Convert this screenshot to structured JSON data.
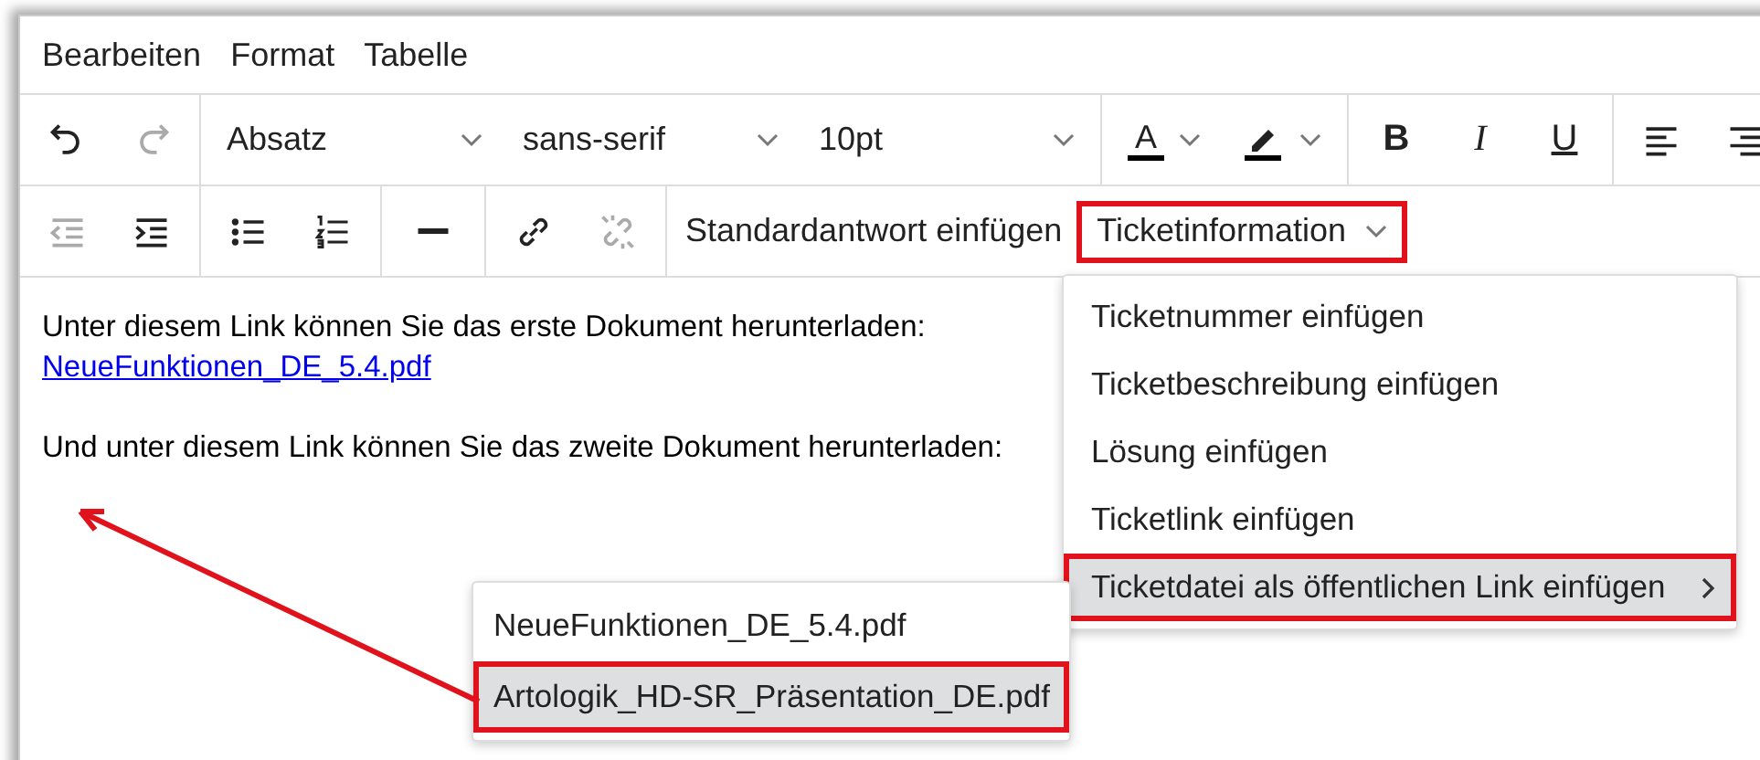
{
  "menubar": [
    {
      "label": "Bearbeiten"
    },
    {
      "label": "Format"
    },
    {
      "label": "Tabelle"
    }
  ],
  "toolbar_row_1": {
    "history": [
      {
        "kind": "undo",
        "disabled": false
      },
      {
        "kind": "redo",
        "disabled": true
      }
    ],
    "selects": [
      {
        "value": "Absatz"
      },
      {
        "value": "sans-serif"
      },
      {
        "value": "10pt"
      }
    ],
    "colors": [
      {
        "kind": "text-color",
        "glyph": "A"
      },
      {
        "kind": "highlight"
      }
    ],
    "formats": [
      {
        "kind": "bold",
        "glyph": "B"
      },
      {
        "kind": "italic",
        "glyph": "I"
      },
      {
        "kind": "underline",
        "glyph": "U"
      }
    ],
    "align": [
      {
        "kind": "left"
      },
      {
        "kind": "right"
      }
    ]
  },
  "toolbar_row_2": {
    "indent": [
      {
        "kind": "outdent",
        "disabled": true
      },
      {
        "kind": "indent",
        "disabled": false
      }
    ],
    "lists": [
      {
        "kind": "bullet"
      },
      {
        "kind": "numbered"
      }
    ],
    "rule": [
      {
        "kind": "hr"
      }
    ],
    "links": [
      {
        "kind": "link",
        "disabled": false
      },
      {
        "kind": "unlink",
        "disabled": true
      }
    ],
    "standard_reply": {
      "label": "Standardantwort einfügen"
    },
    "ticket_info": {
      "label": "Ticketinformation",
      "callout": true
    }
  },
  "content": {
    "paragraphs": [
      {
        "lines": [
          {
            "kind": "text",
            "text": "Unter diesem Link können Sie das erste Dokument herunterladen:"
          },
          {
            "kind": "link",
            "text": "NeueFunktionen_DE_5.4.pdf"
          }
        ]
      },
      {
        "lines": [
          {
            "kind": "text",
            "text": "Und unter diesem Link können Sie das zweite Dokument herunterladen:"
          }
        ]
      }
    ]
  },
  "ticket_menu": {
    "items": [
      {
        "label": "Ticketnummer einfügen",
        "selected": false,
        "callout": false,
        "submenu": false
      },
      {
        "label": "Ticketbeschreibung einfügen",
        "selected": false,
        "callout": false,
        "submenu": false
      },
      {
        "label": "Lösung einfügen",
        "selected": false,
        "callout": false,
        "submenu": false
      },
      {
        "label": "Ticketlink einfügen",
        "selected": false,
        "callout": false,
        "submenu": false
      },
      {
        "label": "Ticketdatei als öffentlichen Link einfügen",
        "selected": true,
        "callout": true,
        "submenu": true
      }
    ]
  },
  "file_submenu": {
    "items": [
      {
        "label": "NeueFunktionen_DE_5.4.pdf",
        "selected": false,
        "callout": false
      },
      {
        "label": "Artologik_HD-SR_Präsentation_DE.pdf",
        "selected": true,
        "callout": true
      }
    ]
  }
}
